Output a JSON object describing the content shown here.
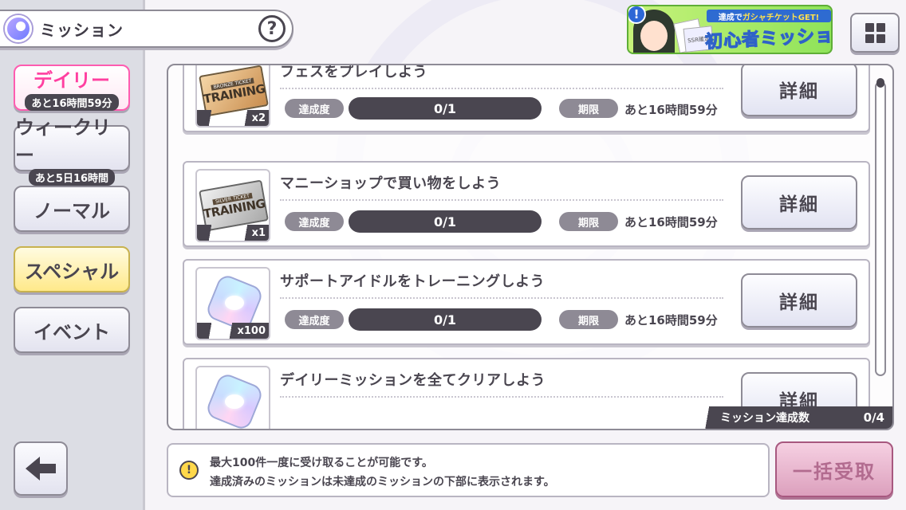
{
  "header": {
    "title": "ミッション",
    "help_label": "?"
  },
  "sidebar": {
    "tabs": [
      {
        "label": "デイリー",
        "sub": "あと16時間59分",
        "active": true
      },
      {
        "label": "ウィークリー",
        "sub": "あと5日16時間"
      },
      {
        "label": "ノーマル"
      },
      {
        "label": "スペシャル"
      },
      {
        "label": "イベント"
      }
    ]
  },
  "banner": {
    "badge": "!",
    "ticket_label": "SSR確定",
    "top_text_a": "達成で",
    "top_text_b": "ガシャチケットGET!",
    "main_text": "初心者ミッション"
  },
  "missions": [
    {
      "title": "フェスをプレイしよう",
      "reward_qty": "x2",
      "reward_label": "BRONZE TICKET",
      "reward_name": "TRAINING",
      "rate_label": "達成度",
      "progress": "0/1",
      "term_label": "期限",
      "term": "あと16時間59分",
      "detail_label": "詳細"
    },
    {
      "title": "マニーショップで買い物をしよう",
      "reward_qty": "x1",
      "reward_label": "SILVER TICKET",
      "reward_name": "TRAINING",
      "rate_label": "達成度",
      "progress": "0/1",
      "term_label": "期限",
      "term": "あと16時間59分",
      "detail_label": "詳細"
    },
    {
      "title": "サポートアイドルをトレーニングしよう",
      "reward_qty": "x100",
      "rate_label": "達成度",
      "progress": "0/1",
      "term_label": "期限",
      "term": "あと16時間59分",
      "detail_label": "詳細"
    },
    {
      "title": "デイリーミッションを全てクリアしよう",
      "detail_label": "詳細"
    }
  ],
  "mission_count": {
    "label": "ミッション達成数",
    "value": "0/4"
  },
  "info": {
    "line1": "最大100件一度に受け取ることが可能です。",
    "line2": "達成済みのミッションは未達成のミッションの下部に表示されます。"
  },
  "claim_all_label": "一括受取",
  "colors": {
    "active_tab": "#ff3fa0",
    "dark": "#4a4650",
    "banner_green": "#8fe35a"
  }
}
